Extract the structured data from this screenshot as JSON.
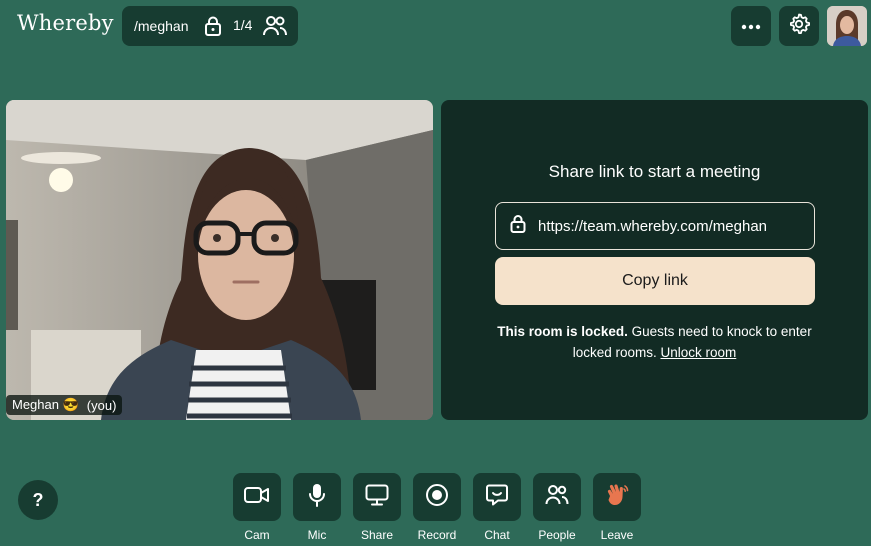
{
  "app": {
    "logo": "Whereby"
  },
  "room": {
    "name": "/meghan",
    "count": "1/4"
  },
  "participant": {
    "name": "Meghan 😎",
    "suffix": "(you)"
  },
  "share": {
    "title": "Share link to start a meeting",
    "url": "https://team.whereby.com/meghan",
    "copy_label": "Copy link",
    "locked_bold": "This room is locked.",
    "locked_rest": " Guests need to knock to enter locked rooms. ",
    "unlock_label": "Unlock room"
  },
  "help": {
    "label": "?"
  },
  "controls": [
    {
      "label": "Cam",
      "icon": "camera-icon"
    },
    {
      "label": "Mic",
      "icon": "microphone-icon"
    },
    {
      "label": "Share",
      "icon": "screen-share-icon"
    },
    {
      "label": "Record",
      "icon": "record-icon"
    },
    {
      "label": "Chat",
      "icon": "chat-icon"
    },
    {
      "label": "People",
      "icon": "people-icon"
    },
    {
      "label": "Leave",
      "icon": "wave-hand-icon"
    }
  ],
  "colors": {
    "background": "#2e6a58",
    "panel": "#122b24",
    "button": "#173c31",
    "copy_button": "#f5e2cb",
    "leave_accent": "#e8764f"
  }
}
